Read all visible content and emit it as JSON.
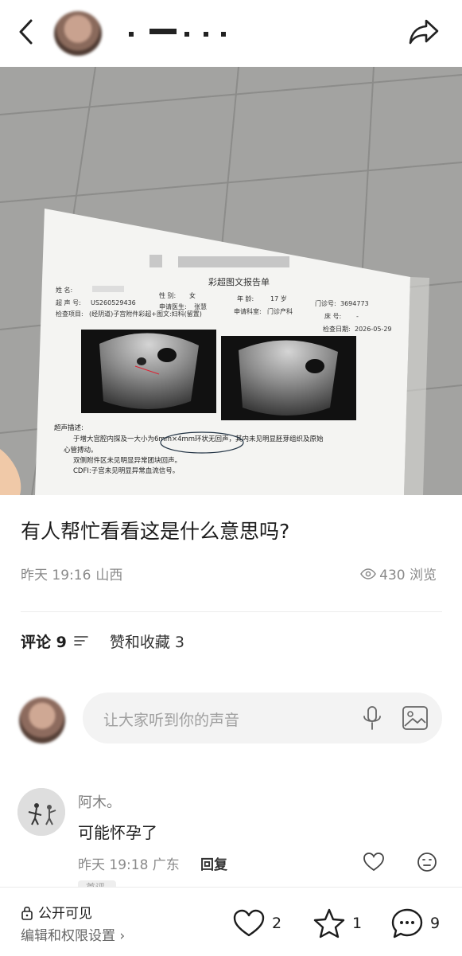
{
  "header": {
    "back_icon": "back-arrow-icon",
    "share_icon": "share-arrow-icon"
  },
  "report": {
    "title": "彩超图文报告单",
    "name_label": "姓    名:",
    "gender_label": "性    别:",
    "gender": "女",
    "age_label": "年    龄:",
    "age": "17 岁",
    "clinic_label": "门诊号:",
    "clinic_no": "3694773",
    "us_label": "超 声 号:",
    "us_no": "US260529436",
    "doctor_label": "申请医生:",
    "doctor": "张慧",
    "dept_label": "申请科室:",
    "dept": "门诊产科",
    "bed_label": "床      号:",
    "bed": "-",
    "item_label": "检查项目:",
    "item": "(经阴道)子宫附件彩超+图文:妇科(留置)",
    "date_label": "检查日期:",
    "date": "2026-05-29",
    "desc_title": "超声描述:",
    "desc_1": "于增大宫腔内探及一大小为6mm×4mm环状无回声，其内未见明显胚芽组织及原始",
    "desc_2": "心管搏动。",
    "desc_3": "双侧附件区未见明显异常团块回声。",
    "desc_4": "CDFI:子宫未见明显异常血流信号。"
  },
  "post": {
    "title": "有人帮忙看看这是什么意思吗?",
    "time": "昨天 19:16",
    "location": "山西",
    "views": "430 浏览"
  },
  "tabs": {
    "comments": "评论 9",
    "likes_favs": "赞和收藏 3"
  },
  "comment_input": {
    "placeholder": "让大家听到你的声音"
  },
  "comment": {
    "author": "阿木。",
    "text": "可能怀孕了",
    "time": "昨天 19:18 广东",
    "reply": "回复",
    "tag": "首评"
  },
  "bottom": {
    "visibility": "公开可见",
    "edit": "编辑和权限设置 ›",
    "likes": "2",
    "favs": "1",
    "comments": "9"
  },
  "colors": {
    "accent_text": "#1c1c1c",
    "muted": "#8a8a8a",
    "input_bg": "#f3f3f3"
  }
}
